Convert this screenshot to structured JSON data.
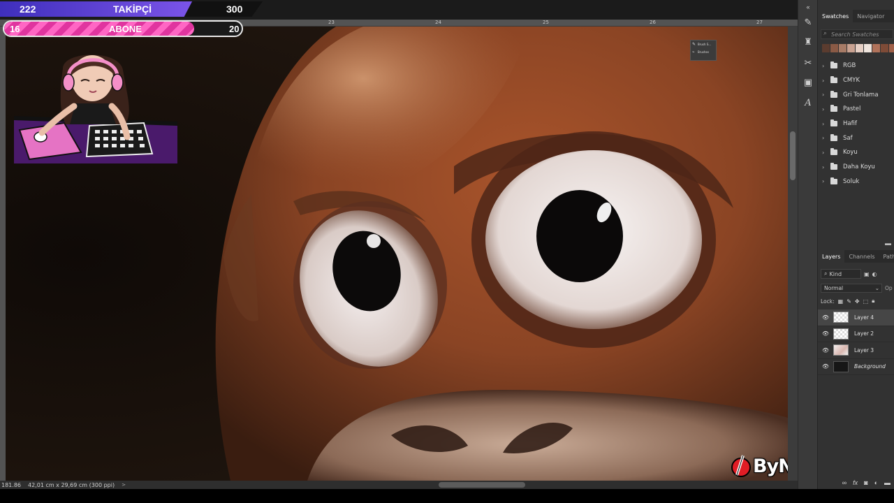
{
  "overlay": {
    "follow_bar": {
      "current": "222",
      "label": "TAKİPÇİ",
      "goal": "300",
      "progress": 0.74,
      "color": "#5a3fd6"
    },
    "sub_bar": {
      "current": "16",
      "label": "ABONE",
      "goal": "20",
      "progress": 0.8,
      "color": "#ff4fb8"
    },
    "logo_text": "ByNoGame",
    "logo_color": "#e11d25"
  },
  "canvas": {
    "ruler_ticks": [
      "23",
      "24",
      "25",
      "26",
      "27"
    ],
    "status": {
      "zoom": "181.86",
      "doc_size": "42,01 cm x 29,69 cm (300 ppi)"
    }
  },
  "float_panel": {
    "items": [
      "Brush S...",
      "Brushes"
    ]
  },
  "toolstrip": {
    "icons": [
      "brush-settings-icon",
      "stamp-icon",
      "scissors-icon",
      "history-icon",
      "character-icon"
    ],
    "collapse": "«"
  },
  "swatches_panel": {
    "tabs": [
      "Swatches",
      "Navigator"
    ],
    "active_tab": "Swatches",
    "search_placeholder": "Search Swatches",
    "recent_colors": [
      "#5b3c2f",
      "#8a5a45",
      "#a77b66",
      "#c9a291",
      "#e6cfc4",
      "#efe4dd",
      "#b0725a",
      "#7e4b37",
      "#a06048"
    ],
    "folders": [
      "RGB",
      "CMYK",
      "Gri Tonlama",
      "Pastel",
      "Hafif",
      "Saf",
      "Koyu",
      "Daha Koyu",
      "Soluk"
    ]
  },
  "layers_panel": {
    "tabs": [
      "Layers",
      "Channels",
      "Paths"
    ],
    "active_tab": "Layers",
    "filter_label": "Kind",
    "blend_mode": "Normal",
    "opacity_label": "Op",
    "lock_label": "Lock:",
    "layers": [
      {
        "name": "Layer 4",
        "selected": true,
        "thumb": "transparent",
        "italic": false
      },
      {
        "name": "Layer 2",
        "selected": false,
        "thumb": "transparent",
        "italic": false
      },
      {
        "name": "Layer 3",
        "selected": false,
        "thumb": "art",
        "italic": false
      },
      {
        "name": "Background",
        "selected": false,
        "thumb": "dark",
        "italic": true
      }
    ],
    "footer_icons": [
      "link-icon",
      "fx-icon",
      "mask-icon",
      "adjustment-icon",
      "group-icon"
    ]
  }
}
